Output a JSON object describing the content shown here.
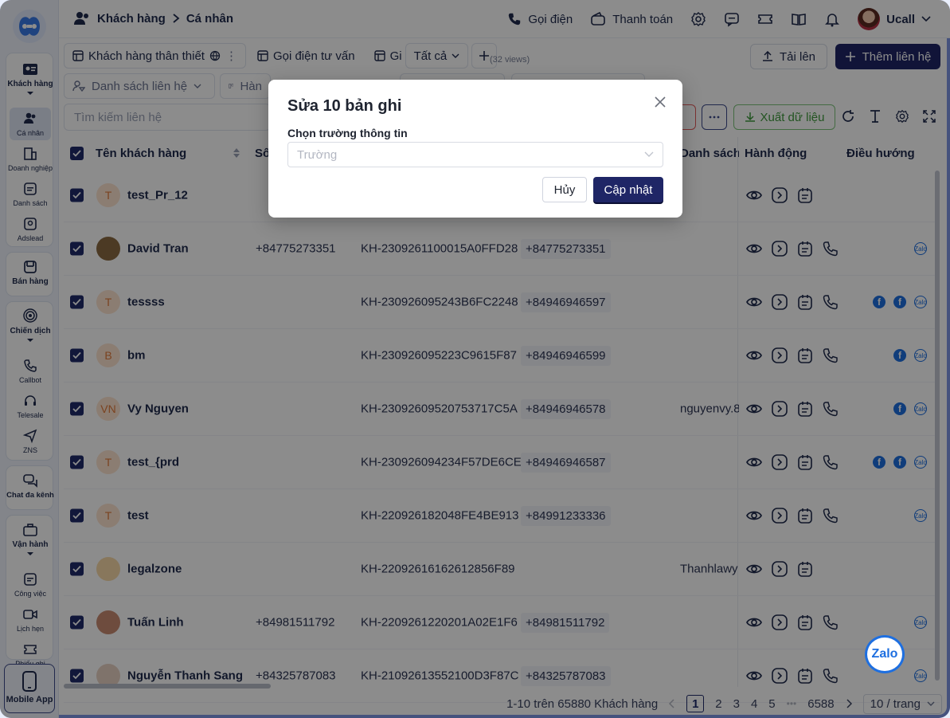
{
  "sidebar": {
    "groups": [
      {
        "label": "Khách hàng",
        "items": [
          "Cá nhân",
          "Doanh nghiệp",
          "Danh sách",
          "Adslead"
        ]
      },
      {
        "label": "Bán hàng"
      },
      {
        "label": "Chiến dịch",
        "items": [
          "Callbot",
          "Telesale",
          "ZNS"
        ]
      },
      {
        "label": "Chat đa kênh"
      },
      {
        "label": "Vận hành",
        "items": [
          "Công việc",
          "Lịch hẹn",
          "Phiếu ghi"
        ]
      }
    ],
    "mobile_app": "Mobile App"
  },
  "topbar": {
    "breadcrumb_root": "Khách hàng",
    "breadcrumb_current": "Cá nhân",
    "call_label": "Gọi điện",
    "payment_label": "Thanh toán",
    "user_name": "Ucall"
  },
  "tabs": {
    "items": [
      "Khách hàng thân thiết",
      "Gọi điện tư vấn",
      "Gi"
    ],
    "all_label": "Tất cả",
    "views_count": "(32 views)",
    "upload_label": "Tải lên",
    "add_label": "Thêm liên hệ"
  },
  "filters": {
    "contact_list": "Danh sách liên hệ",
    "second": "Hàn",
    "search_placeholder": "Tìm kiếm liên hệ",
    "export_label": "Xuất dữ liệu"
  },
  "table": {
    "headers": {
      "name": "Tên khách hàng",
      "phone": "Số",
      "email_list": "Danh sách e",
      "actions": "Hành động",
      "navigation": "Điều hướng"
    },
    "rows": [
      {
        "initials": "T",
        "name": "test_Pr_12",
        "phone": "",
        "code": "",
        "phone2": "",
        "email": "",
        "call": false,
        "nav": []
      },
      {
        "initials": "",
        "name": "David Tran",
        "phone": "+84775273351",
        "code": "KH-2309261100015A0FFD28",
        "phone2": "+84775273351",
        "email": "",
        "call": true,
        "nav": [
          "zalo"
        ]
      },
      {
        "initials": "T",
        "name": "tessss",
        "phone": "",
        "code": "KH-230926095243B6FC2248",
        "phone2": "+84946946597",
        "email": "",
        "call": true,
        "nav": [
          "fb",
          "fb",
          "zalo"
        ]
      },
      {
        "initials": "B",
        "name": "bm",
        "phone": "",
        "code": "KH-230926095223C9615F87",
        "phone2": "+84946946599",
        "email": "",
        "call": true,
        "nav": [
          "fb",
          "zalo"
        ]
      },
      {
        "initials": "VN",
        "name": "Vy Nguyen",
        "phone": "",
        "code": "KH-23092609520753717C5A",
        "phone2": "+84946946578",
        "email": "nguyenvy.8",
        "call": true,
        "nav": [
          "fb",
          "zalo"
        ]
      },
      {
        "initials": "T",
        "name": "test_{prd",
        "phone": "",
        "code": "KH-230926094234F57DE6CE",
        "phone2": "+84946946587",
        "email": "",
        "call": true,
        "nav": [
          "fb",
          "fb",
          "zalo"
        ]
      },
      {
        "initials": "T",
        "name": "test",
        "phone": "",
        "code": "KH-220926182048FE4BE913",
        "phone2": "+84991233336",
        "email": "",
        "call": true,
        "nav": [
          "zalo"
        ]
      },
      {
        "initials": "",
        "name": "legalzone",
        "phone": "",
        "code": "KH-22092616162612856F89",
        "phone2": "",
        "email": "Thanhlawy",
        "call": false,
        "nav": []
      },
      {
        "initials": "",
        "name": "Tuấn Linh",
        "phone": "+84981511792",
        "code": "KH-2209261220201A02E1F6",
        "phone2": "+84981511792",
        "email": "",
        "call": true,
        "nav": [
          "zalo"
        ]
      },
      {
        "initials": "",
        "name": "Nguyễn Thanh Sang",
        "phone": "+84325787083",
        "code": "KH-21092613552100D3F87C",
        "phone2": "+84325787083",
        "email": "",
        "call": true,
        "nav": [
          "zalo"
        ]
      }
    ]
  },
  "footer": {
    "summary": "1-10 trên 65880 Khách hàng",
    "pages": [
      "1",
      "2",
      "3",
      "4",
      "5"
    ],
    "ellipsis": "•••",
    "last_page": "6588",
    "per_page": "10 / trang"
  },
  "modal": {
    "title": "Sửa 10 bản ghi",
    "field_label": "Chọn trường thông tin",
    "field_placeholder": "Trường",
    "cancel_label": "Hủy",
    "submit_label": "Cập nhật"
  },
  "zalo_label": "Zalo",
  "colors": {
    "primary": "#1f2666",
    "export_green": "#3f9a3c",
    "facebook": "#1e6fe0"
  }
}
